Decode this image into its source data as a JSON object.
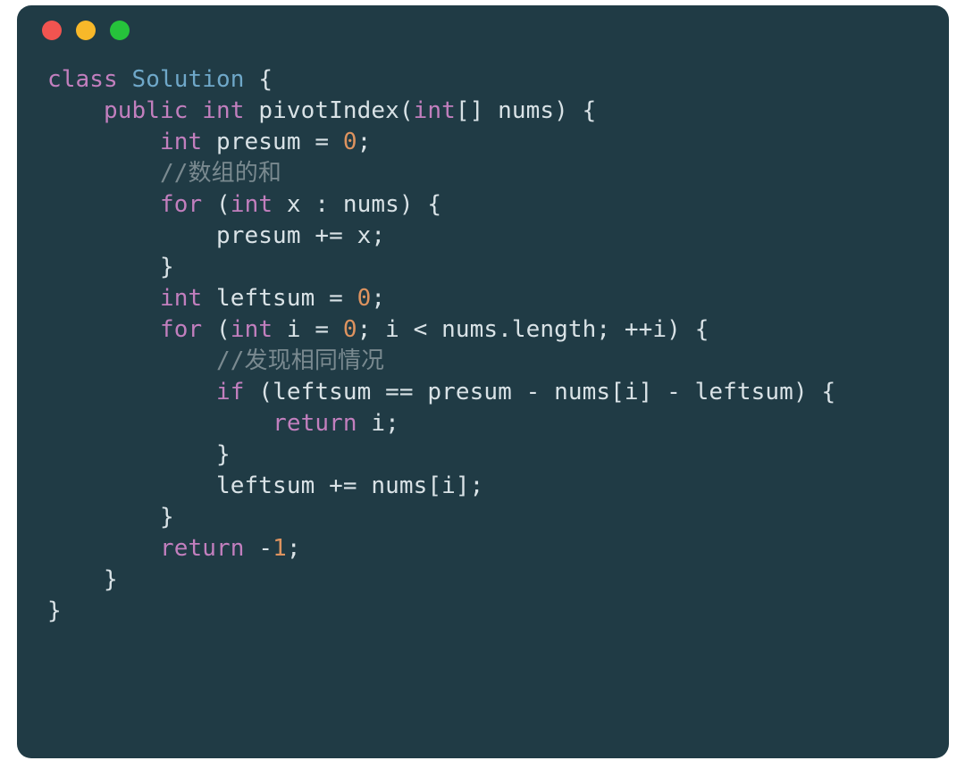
{
  "window": {
    "traffic_lights": {
      "close": "#F15450",
      "minimize": "#F8B829",
      "zoom": "#26C33B"
    },
    "background": "#203B45"
  },
  "code": {
    "lines": [
      {
        "indent": 0,
        "tokens": [
          {
            "t": "class ",
            "c": "kw"
          },
          {
            "t": "Solution ",
            "c": "cls"
          },
          {
            "t": "{",
            "c": "punc"
          }
        ]
      },
      {
        "indent": 1,
        "tokens": [
          {
            "t": "public ",
            "c": "kw"
          },
          {
            "t": "int ",
            "c": "type"
          },
          {
            "t": "pivotIndex(",
            "c": "punc"
          },
          {
            "t": "int",
            "c": "type"
          },
          {
            "t": "[] nums) {",
            "c": "punc"
          }
        ]
      },
      {
        "indent": 2,
        "tokens": [
          {
            "t": "int ",
            "c": "type"
          },
          {
            "t": "presum = ",
            "c": "punc"
          },
          {
            "t": "0",
            "c": "num"
          },
          {
            "t": ";",
            "c": "punc"
          }
        ]
      },
      {
        "indent": 2,
        "tokens": [
          {
            "t": "//数组的和",
            "c": "cmt"
          }
        ]
      },
      {
        "indent": 2,
        "tokens": [
          {
            "t": "for ",
            "c": "kw"
          },
          {
            "t": "(",
            "c": "punc"
          },
          {
            "t": "int ",
            "c": "type"
          },
          {
            "t": "x : nums) {",
            "c": "punc"
          }
        ]
      },
      {
        "indent": 3,
        "tokens": [
          {
            "t": "presum += x;",
            "c": "punc"
          }
        ]
      },
      {
        "indent": 2,
        "tokens": [
          {
            "t": "}",
            "c": "punc"
          }
        ]
      },
      {
        "indent": 2,
        "tokens": [
          {
            "t": "int ",
            "c": "type"
          },
          {
            "t": "leftsum = ",
            "c": "punc"
          },
          {
            "t": "0",
            "c": "num"
          },
          {
            "t": ";",
            "c": "punc"
          }
        ]
      },
      {
        "indent": 2,
        "tokens": [
          {
            "t": "for ",
            "c": "kw"
          },
          {
            "t": "(",
            "c": "punc"
          },
          {
            "t": "int ",
            "c": "type"
          },
          {
            "t": "i = ",
            "c": "punc"
          },
          {
            "t": "0",
            "c": "num"
          },
          {
            "t": "; i < nums.length; ++i) {",
            "c": "punc"
          }
        ]
      },
      {
        "indent": 3,
        "tokens": [
          {
            "t": "//发现相同情况",
            "c": "cmt"
          }
        ]
      },
      {
        "indent": 3,
        "tokens": [
          {
            "t": "if ",
            "c": "kw"
          },
          {
            "t": "(leftsum == presum - nums[i] - leftsum) {",
            "c": "punc"
          }
        ]
      },
      {
        "indent": 4,
        "tokens": [
          {
            "t": "return ",
            "c": "kw"
          },
          {
            "t": "i;",
            "c": "punc"
          }
        ]
      },
      {
        "indent": 3,
        "tokens": [
          {
            "t": "}",
            "c": "punc"
          }
        ]
      },
      {
        "indent": 3,
        "tokens": [
          {
            "t": "leftsum += nums[i];",
            "c": "punc"
          }
        ]
      },
      {
        "indent": 2,
        "tokens": [
          {
            "t": "}",
            "c": "punc"
          }
        ]
      },
      {
        "indent": 2,
        "tokens": [
          {
            "t": "return ",
            "c": "kw"
          },
          {
            "t": "-",
            "c": "punc"
          },
          {
            "t": "1",
            "c": "num"
          },
          {
            "t": ";",
            "c": "punc"
          }
        ]
      },
      {
        "indent": 1,
        "tokens": [
          {
            "t": "}",
            "c": "punc"
          }
        ]
      },
      {
        "indent": 0,
        "tokens": [
          {
            "t": "}",
            "c": "punc"
          }
        ]
      }
    ],
    "indent_unit": "    "
  }
}
